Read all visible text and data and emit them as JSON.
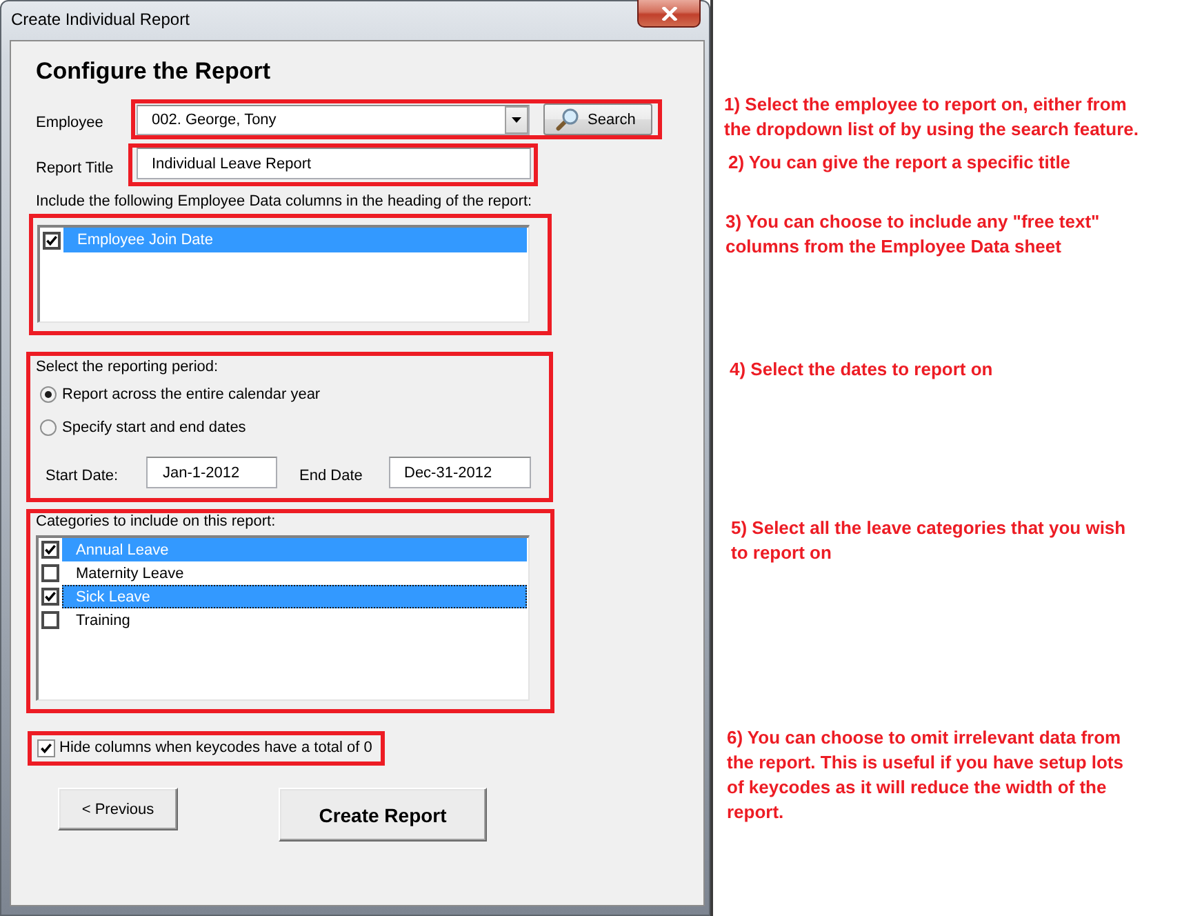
{
  "window": {
    "title": "Create Individual Report"
  },
  "heading": "Configure the Report",
  "employee": {
    "label": "Employee",
    "value": "002. George, Tony",
    "search_button": "Search"
  },
  "report_title": {
    "label": "Report Title",
    "value": "Individual Leave Report"
  },
  "employee_columns": {
    "label": "Include the following Employee Data columns in the heading of the report:",
    "items": [
      {
        "label": "Employee Join Date",
        "checked": true,
        "selected": true,
        "focused": false
      }
    ]
  },
  "reporting_period": {
    "label": "Select the reporting period:",
    "options": [
      {
        "label": "Report across the entire calendar year",
        "selected": true
      },
      {
        "label": "Specify start and end dates",
        "selected": false
      }
    ],
    "start_date": {
      "label": "Start Date:",
      "value": "Jan-1-2012"
    },
    "end_date": {
      "label": "End Date",
      "value": "Dec-31-2012"
    }
  },
  "categories": {
    "label": "Categories to include on this report:",
    "items": [
      {
        "label": "Annual Leave",
        "checked": true,
        "selected": true,
        "focused": false
      },
      {
        "label": "Maternity Leave",
        "checked": false,
        "selected": false,
        "focused": false
      },
      {
        "label": "Sick Leave",
        "checked": true,
        "selected": true,
        "focused": true
      },
      {
        "label": "Training",
        "checked": false,
        "selected": false,
        "focused": false
      }
    ]
  },
  "hide_zero_columns": {
    "label": "Hide columns when keycodes have a total of 0",
    "checked": true
  },
  "buttons": [
    {
      "label": "< Previous",
      "kind": "secondary"
    },
    {
      "label": "Create Report",
      "kind": "primary"
    }
  ],
  "notes": [
    "1) Select the employee to report on, either from the dropdown list of by using the search feature.",
    "2) You can give the report a specific title",
    "3) You can choose to include any \"free text\" columns from the Employee Data sheet",
    "4) Select the dates to report on",
    "5) Select all the leave categories that you wish to report on",
    "6) You can choose to omit irrelevant data from the report. This is useful if you have setup lots of keycodes as it will reduce the width of the report."
  ]
}
